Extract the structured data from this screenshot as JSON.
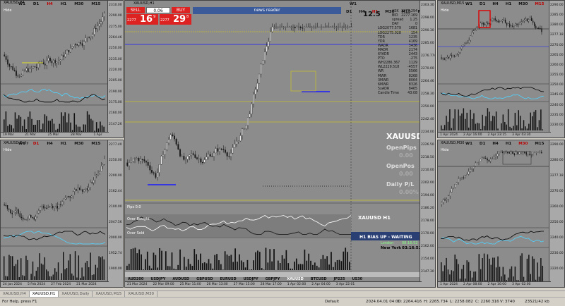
{
  "windows": {
    "h4": {
      "title": "XAUUSD,H4",
      "hide": "Hide",
      "tfs": [
        "W1",
        "D1",
        "H4",
        "H1",
        "M30",
        "M15",
        "M5"
      ],
      "active_tf": "H4",
      "prices": [
        "2310.00",
        "2290.00",
        "2275.00",
        "2264.46",
        "2250.00",
        "2235.00",
        "2220.00",
        "2205.00",
        "2190.00",
        "2175.00",
        "2160.00",
        "2147.26"
      ],
      "dates": [
        "19 Mar 2024",
        "21 Mar 08:00",
        "25 Mar 08:00",
        "28 Mar 08:00",
        "1 Apr 22:05"
      ]
    },
    "daily": {
      "title": "XAUUSD,Daily",
      "hide": "Hide",
      "tfs": [
        "W1",
        "D1",
        "H4",
        "H1",
        "M30",
        "M15",
        "M5"
      ],
      "active_tf": "D1",
      "prices": [
        "2277.40",
        "2250.00",
        "2200.00",
        "2162.44",
        "2100.00",
        "2047.56",
        "2000.00",
        "1952.74",
        "1900.00"
      ],
      "dates": [
        "24 Jan 2024",
        "5 Feb 2024",
        "27 Feb 2024",
        "21 Mar 2024"
      ]
    },
    "h1": {
      "title": "XAUUSD,H1",
      "tfs": [
        "W1",
        "D1",
        "H4",
        "H1",
        "M30",
        "M15",
        "M5"
      ],
      "active_tf": "H1",
      "sell_label": "SELL",
      "buy_label": "BUY",
      "lot": "0.06",
      "sell_big": "16",
      "sell_sup": "9",
      "sell_pre": "2277",
      "buy_big": "29",
      "buy_sup": "8",
      "buy_pre": "2277",
      "news_reader": "news reader",
      "prices": [
        "2303.30",
        "2298.00",
        "2290.30",
        "2285.00",
        "2276.774",
        "2270.00",
        "2264.46",
        "2258.30",
        "2250.00",
        "2242.40",
        "2234.00",
        "2226.50",
        "2218.50",
        "2210.00",
        "2202.00",
        "2194.00",
        "2186.20",
        "2178.00",
        "2170.00",
        "2162.00",
        "2154.00",
        "2147.30"
      ],
      "dates": [
        "21 Mar 2024",
        "22 Mar 09:00",
        "25 Mar 11:00",
        "26 Mar 13:00",
        "27 Mar 15:00",
        "28 Mar 17:00",
        "1 Apr 02:00",
        "2 Apr 04:00",
        "3 Apr 22:01"
      ],
      "pips_label": "Pips 0.0",
      "symbol_big": "XAUUSD",
      "right_labels": [
        "OpenPips",
        "OpenPos",
        "Daily P/L"
      ],
      "right_values": [
        "0.00",
        "0.00",
        "0.00%"
      ],
      "bias_symbol": "XAUUSD  H1",
      "bias_text": "H1  BIAS UP - WAITING",
      "london_label": "London",
      "london_time": "08:16:52",
      "newyork_label": "New York",
      "newyork_time": "03:16:52",
      "overbought": "Over Bought",
      "oversold": "Over Sold",
      "currencies": [
        "AUD200",
        "USDJPY",
        "AUDUSD",
        "GBPUSD",
        "EURUSD",
        "USDJPY",
        "GBPJPY",
        "XAUUSD",
        "BTCUSD",
        "JP225",
        "US30"
      ],
      "info_big": "12.5",
      "info": [
        [
          "ASK",
          "2277.294"
        ],
        [
          "BID",
          "2277.169"
        ],
        [
          "spread",
          "1.25"
        ],
        [
          "DAY",
          "0"
        ],
        [
          "LOG2077.579",
          "1681"
        ],
        [
          "LOG2275.028",
          "154"
        ],
        [
          "TDR",
          "1235"
        ],
        [
          "YDR",
          "4169"
        ],
        [
          "WADR",
          "3436"
        ],
        [
          "MADR",
          "2174"
        ],
        [
          "6YADR",
          "2443"
        ],
        [
          "PTO",
          "-275"
        ],
        [
          "WH2286.367",
          "1129"
        ],
        [
          "WL2229.518",
          "-4557"
        ],
        [
          "WR",
          "5566"
        ],
        [
          "MWR",
          "8268"
        ],
        [
          "3MWR",
          "8064"
        ],
        [
          "6MWR",
          "8326"
        ],
        [
          "5xADR",
          "8465"
        ],
        [
          "Candle Time",
          "43:08"
        ]
      ]
    },
    "m15": {
      "title": "XAUUSD,M15",
      "hide": "Hide",
      "tfs": [
        "W1",
        "D1",
        "H4",
        "H1",
        "M30",
        "M15",
        "M5"
      ],
      "active_tf": "M15",
      "prices": [
        "2290.00",
        "2285.00",
        "2280.00",
        "2277.18",
        "2270.00",
        "2265.00",
        "2260.00",
        "2255.00",
        "2250.00",
        "2245.00",
        "2240.00",
        "2235.00",
        "2230.00"
      ],
      "dates": [
        "1 Apr 2024",
        "2 Apr 16:00",
        "2 Apr 23:15",
        "3 Apr 03:30"
      ]
    },
    "m30": {
      "title": "XAUUSD,M30",
      "hide": "Hide",
      "tfs": [
        "W1",
        "D1",
        "H4",
        "H1",
        "M30",
        "M15",
        "M5"
      ],
      "active_tf": "M30",
      "prices": [
        "2290.00",
        "2280.00",
        "2277.18",
        "2270.00",
        "2260.00",
        "2250.00",
        "2240.00",
        "2230.00",
        "2220.00"
      ],
      "dates": [
        "1 Apr 2024",
        "2 Apr 08:00",
        "2 Apr 16:00",
        "3 Apr 02:00"
      ]
    }
  },
  "tabs": [
    "XAUUSD,H4",
    "XAUUSD,H1",
    "XAUUSD,Daily",
    "XAUUSD,M15",
    "XAUUSD,M30"
  ],
  "active_tab": "XAUUSD,H1",
  "status": {
    "help": "For Help, press F1",
    "profile": "Default",
    "time": "2024.04.01 04:00",
    "o": "O: 2264.416",
    "h": "H: 2265.734",
    "l": "L: 2258.082",
    "c": "C: 2260.316",
    "v": "V: 3740",
    "kb": "23521/42 kb"
  },
  "colors": {
    "up": "#f0f0f0",
    "down": "#1a1a1a",
    "bg": "#8c8c8c",
    "ma": "#1a1aff",
    "bias": "#c8c8c8"
  }
}
